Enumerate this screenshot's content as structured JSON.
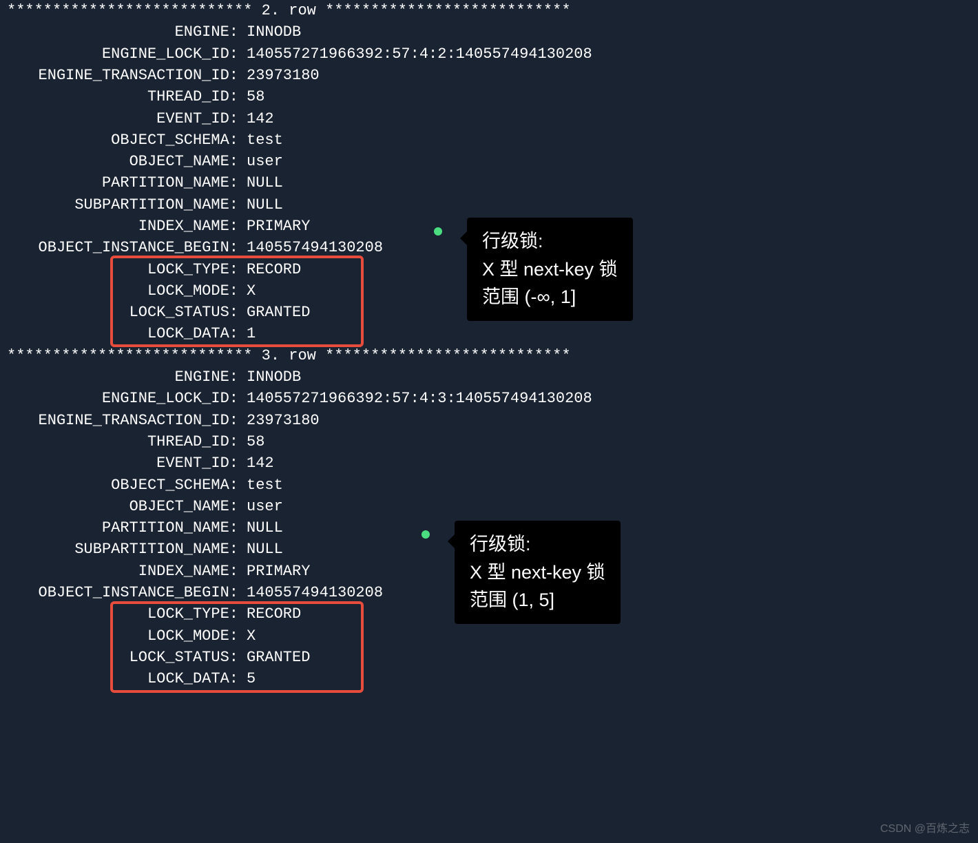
{
  "rows": [
    {
      "header": "*************************** 2. row ***************************"
    },
    {
      "label": "ENGINE:",
      "value": "INNODB"
    },
    {
      "label": "ENGINE_LOCK_ID:",
      "value": "140557271966392:57:4:2:140557494130208"
    },
    {
      "label": "ENGINE_TRANSACTION_ID:",
      "value": "23973180"
    },
    {
      "label": "THREAD_ID:",
      "value": "58"
    },
    {
      "label": "EVENT_ID:",
      "value": "142"
    },
    {
      "label": "OBJECT_SCHEMA:",
      "value": "test"
    },
    {
      "label": "OBJECT_NAME:",
      "value": "user"
    },
    {
      "label": "PARTITION_NAME:",
      "value": "NULL"
    },
    {
      "label": "SUBPARTITION_NAME:",
      "value": "NULL"
    },
    {
      "label": "INDEX_NAME:",
      "value": "PRIMARY"
    },
    {
      "label": "OBJECT_INSTANCE_BEGIN:",
      "value": "140557494130208"
    },
    {
      "label": "LOCK_TYPE:",
      "value": "RECORD"
    },
    {
      "label": "LOCK_MODE:",
      "value": "X"
    },
    {
      "label": "LOCK_STATUS:",
      "value": "GRANTED"
    },
    {
      "label": "LOCK_DATA:",
      "value": "1"
    },
    {
      "header": "*************************** 3. row ***************************"
    },
    {
      "label": "ENGINE:",
      "value": "INNODB"
    },
    {
      "label": "ENGINE_LOCK_ID:",
      "value": "140557271966392:57:4:3:140557494130208"
    },
    {
      "label": "ENGINE_TRANSACTION_ID:",
      "value": "23973180"
    },
    {
      "label": "THREAD_ID:",
      "value": "58"
    },
    {
      "label": "EVENT_ID:",
      "value": "142"
    },
    {
      "label": "OBJECT_SCHEMA:",
      "value": "test"
    },
    {
      "label": "OBJECT_NAME:",
      "value": "user"
    },
    {
      "label": "PARTITION_NAME:",
      "value": "NULL"
    },
    {
      "label": "SUBPARTITION_NAME:",
      "value": "NULL"
    },
    {
      "label": "INDEX_NAME:",
      "value": "PRIMARY"
    },
    {
      "label": "OBJECT_INSTANCE_BEGIN:",
      "value": "140557494130208"
    },
    {
      "label": "LOCK_TYPE:",
      "value": "RECORD"
    },
    {
      "label": "LOCK_MODE:",
      "value": "X"
    },
    {
      "label": "LOCK_STATUS:",
      "value": "GRANTED"
    },
    {
      "label": "LOCK_DATA:",
      "value": "5"
    }
  ],
  "tooltips": [
    {
      "line1": "行级锁:",
      "line2": "X 型 next-key 锁",
      "line3": "范围 (-∞, 1]"
    },
    {
      "line1": "行级锁:",
      "line2": "X 型 next-key 锁",
      "line3": "范围 (1, 5]"
    }
  ],
  "watermark": "CSDN @百炼之志"
}
